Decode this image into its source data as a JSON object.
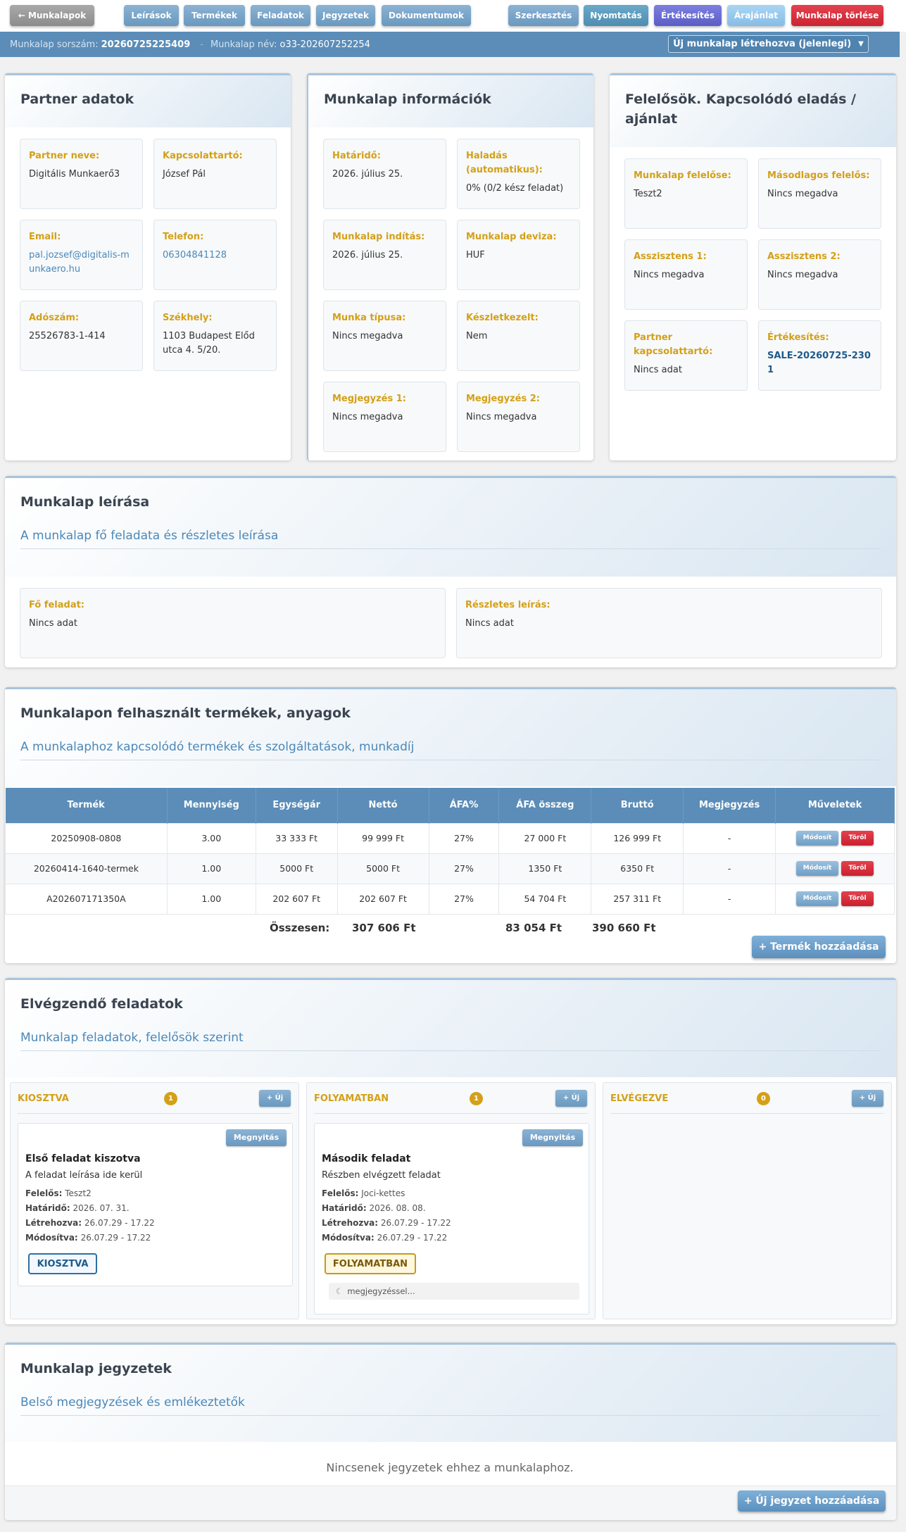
{
  "nav": {
    "back": "← Munkalapok",
    "tabs": [
      "Leírások",
      "Termékek",
      "Feladatok",
      "Jegyzetek",
      "Dokumentumok"
    ],
    "actions": {
      "edit": "Szerkesztés",
      "print": "Nyomtatás",
      "sale": "Értékesítés",
      "quote": "Árajánlat",
      "delete": "Munkalap törlése"
    }
  },
  "infobar": {
    "serial_label": "Munkalap sorszám:",
    "serial": "20260725225409",
    "sep": "-",
    "name_label": "Munkalap név:",
    "name": "o33-202607252254",
    "status_select": "Új munkalap létrehozva (jelenlegi)"
  },
  "partner": {
    "title": "Partner adatok",
    "name_label": "Partner neve:",
    "name": "Digitális Munkaerő3",
    "contact_label": "Kapcsolattartó:",
    "contact": "József Pál",
    "email_label": "Email:",
    "email": "pal.jozsef@digitalis-munkaero.hu",
    "phone_label": "Telefon:",
    "phone": "06304841128",
    "tax_label": "Adószám:",
    "tax": "25526783-1-414",
    "hq_label": "Székhely:",
    "hq": "1103 Budapest Előd utca 4. 5/20."
  },
  "info": {
    "title": "Munkalap információk",
    "deadline_label": "Határidő:",
    "deadline": "2026. július 25.",
    "progress_label": "Haladás (automatikus):",
    "progress": "0% (0/2 kész feladat)",
    "start_label": "Munkalap indítás:",
    "start": "2026. július 25.",
    "currency_label": "Munkalap deviza:",
    "currency": "HUF",
    "worktype_label": "Munka típusa:",
    "worktype": "Nincs megadva",
    "stock_label": "Készletkezelt:",
    "stock": "Nem",
    "note1_label": "Megjegyzés 1:",
    "note1": "Nincs megadva",
    "note2_label": "Megjegyzés 2:",
    "note2": "Nincs megadva"
  },
  "resp": {
    "title": "Felelősök. Kapcsolódó eladás / ajánlat",
    "owner_label": "Munkalap felelőse:",
    "owner": "Teszt2",
    "second_label": "Másodlagos felelős:",
    "second": "Nincs megadva",
    "a1_label": "Asszisztens 1:",
    "a1": "Nincs megadva",
    "a2_label": "Asszisztens 2:",
    "a2": "Nincs megadva",
    "pc_label": "Partner kapcsolattartó:",
    "pc": "Nincs adat",
    "sale_label": "Értékesítés:",
    "sale": "SALE-20260725-2301"
  },
  "desc": {
    "title": "Munkalap leírása",
    "subtitle": "A munkalap fő feladata és részletes leírása",
    "main_label": "Fő feladat:",
    "main": "Nincs adat",
    "detail_label": "Részletes leírás:",
    "detail": "Nincs adat"
  },
  "products": {
    "title": "Munkalapon felhasznált termékek, anyagok",
    "subtitle": "A munkalaphoz kapcsolódó termékek és szolgáltatások, munkadíj",
    "columns": [
      "Termék",
      "Mennyiség",
      "Egységár",
      "Nettó",
      "ÁFA%",
      "ÁFA összeg",
      "Bruttó",
      "Megjegyzés",
      "Műveletek"
    ],
    "rows": [
      [
        "20250908-0808",
        "3.00",
        "33 333 Ft",
        "99 999 Ft",
        "27%",
        "27 000 Ft",
        "126 999 Ft",
        "-"
      ],
      [
        "20260414-1640-termek",
        "1.00",
        "5000 Ft",
        "5000 Ft",
        "27%",
        "1350 Ft",
        "6350 Ft",
        "-"
      ],
      [
        "A202607171350A",
        "1.00",
        "202 607 Ft",
        "202 607 Ft",
        "27%",
        "54 704 Ft",
        "257 311 Ft",
        "-"
      ]
    ],
    "edit_label": "Módosít",
    "delete_label": "Töröl",
    "total_label": "Összesen:",
    "total_net": "307 606 Ft",
    "total_vat": "83 054 Ft",
    "total_gross": "390 660 Ft",
    "add_label": "+ Termék hozzáadása"
  },
  "tasks": {
    "title": "Elvégzendő feladatok",
    "subtitle": "Munkalap feladatok, felelősök szerint",
    "new_label": "+ Új",
    "open_label": "Megnyitás",
    "responsible_label": "Felelős:",
    "deadline_label": "Határidő:",
    "created_label": "Létrehozva:",
    "modified_label": "Módosítva:",
    "columns": [
      {
        "title": "KIOSZTVA",
        "count": "1"
      },
      {
        "title": "FOLYAMATBAN",
        "count": "1"
      },
      {
        "title": "ELVÉGEZVE",
        "count": "0"
      }
    ],
    "task1": {
      "title": "Első feladat kiszotva",
      "desc": "A feladat leírása ide kerül",
      "responsible": "Teszt2",
      "deadline": "2026. 07. 31.",
      "created": "26.07.29 - 17.22",
      "modified": "26.07.29 - 17.22",
      "badge": "KIOSZTVA"
    },
    "task2": {
      "title": "Második feladat",
      "desc": "Részben elvégzett feladat",
      "responsible": "Joci-kettes",
      "deadline": "2026. 08. 08.",
      "created": "26.07.29 - 17.22",
      "modified": "26.07.29 - 17.22",
      "badge": "FOLYAMATBAN",
      "note": "megjegyzéssel..."
    }
  },
  "notes": {
    "title": "Munkalap jegyzetek",
    "subtitle": "Belső megjegyzések és emlékeztetők",
    "empty": "Nincsenek jegyzetek ehhez a munkalaphoz.",
    "add_label": "+ Új jegyzet hozzáadása"
  }
}
